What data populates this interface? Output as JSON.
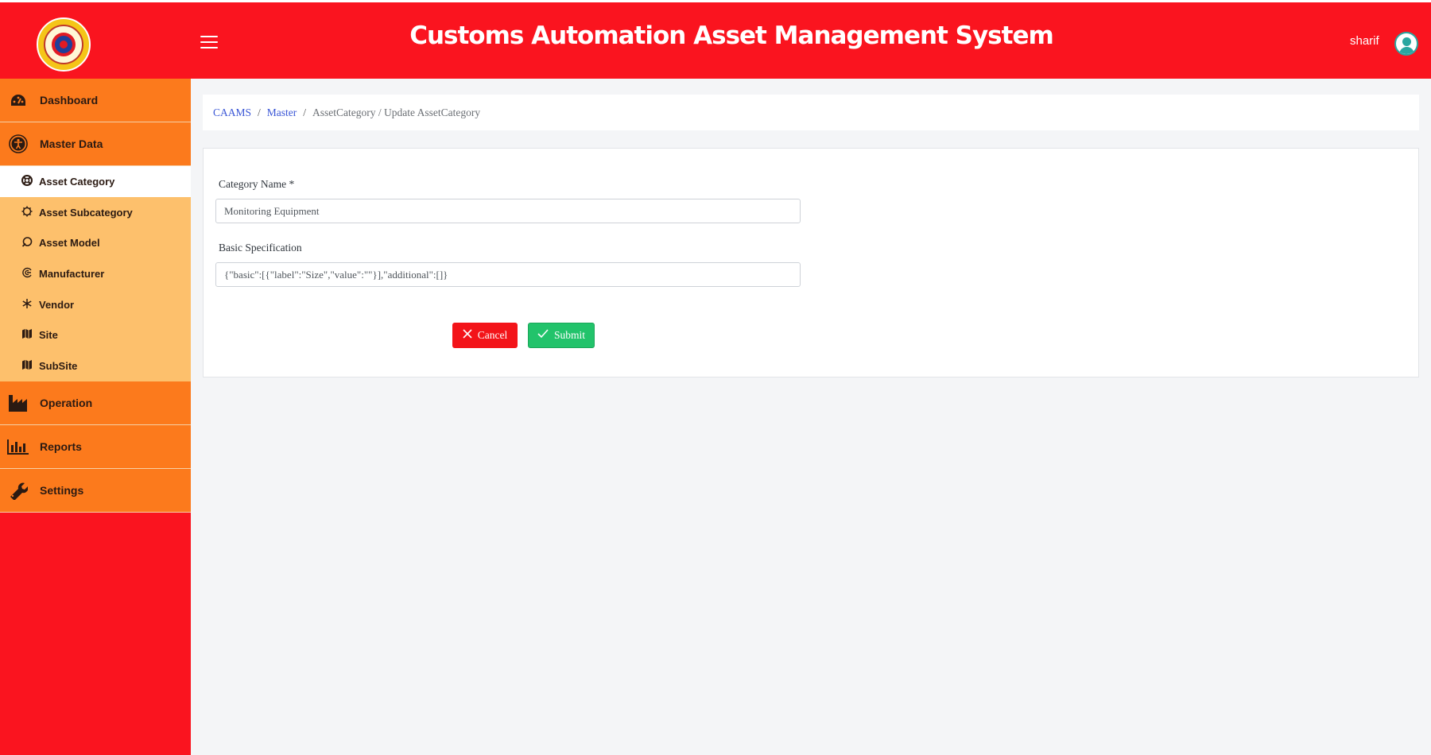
{
  "header": {
    "title": "Customs Automation Asset Management System",
    "username": "sharif"
  },
  "sidebar": {
    "dashboard": "Dashboard",
    "master_data": "Master Data",
    "sub_items": [
      {
        "label": "Asset Category",
        "icon": "life-ring-icon",
        "active": true
      },
      {
        "label": "Asset Subcategory",
        "icon": "cog-icon",
        "active": false
      },
      {
        "label": "Asset Model",
        "icon": "circle-slash-icon",
        "active": false
      },
      {
        "label": "Manufacturer",
        "icon": "swirl-icon",
        "active": false
      },
      {
        "label": "Vendor",
        "icon": "snowflake-icon",
        "active": false
      },
      {
        "label": "Site",
        "icon": "map-icon",
        "active": false
      },
      {
        "label": "SubSite",
        "icon": "map-icon",
        "active": false
      }
    ],
    "operation": "Operation",
    "reports": "Reports",
    "settings": "Settings"
  },
  "breadcrumb": {
    "root": "CAAMS",
    "master": "Master",
    "current": "AssetCategory / Update AssetCategory"
  },
  "form": {
    "category_name_label": "Category Name *",
    "category_name_value": "Monitoring Equipment",
    "basic_spec_label": "Basic Specification",
    "basic_spec_value": "{\"basic\":[{\"label\":\"Size\",\"value\":\"\"}],\"additional\":[]}",
    "cancel_label": "Cancel",
    "submit_label": "Submit"
  },
  "colors": {
    "header_bg": "#fa141f",
    "sidebar_main": "#fc7a1c",
    "sidebar_sub": "#fdc06c",
    "link": "#3a56d6",
    "cancel": "#f31419",
    "submit": "#22c36b"
  }
}
